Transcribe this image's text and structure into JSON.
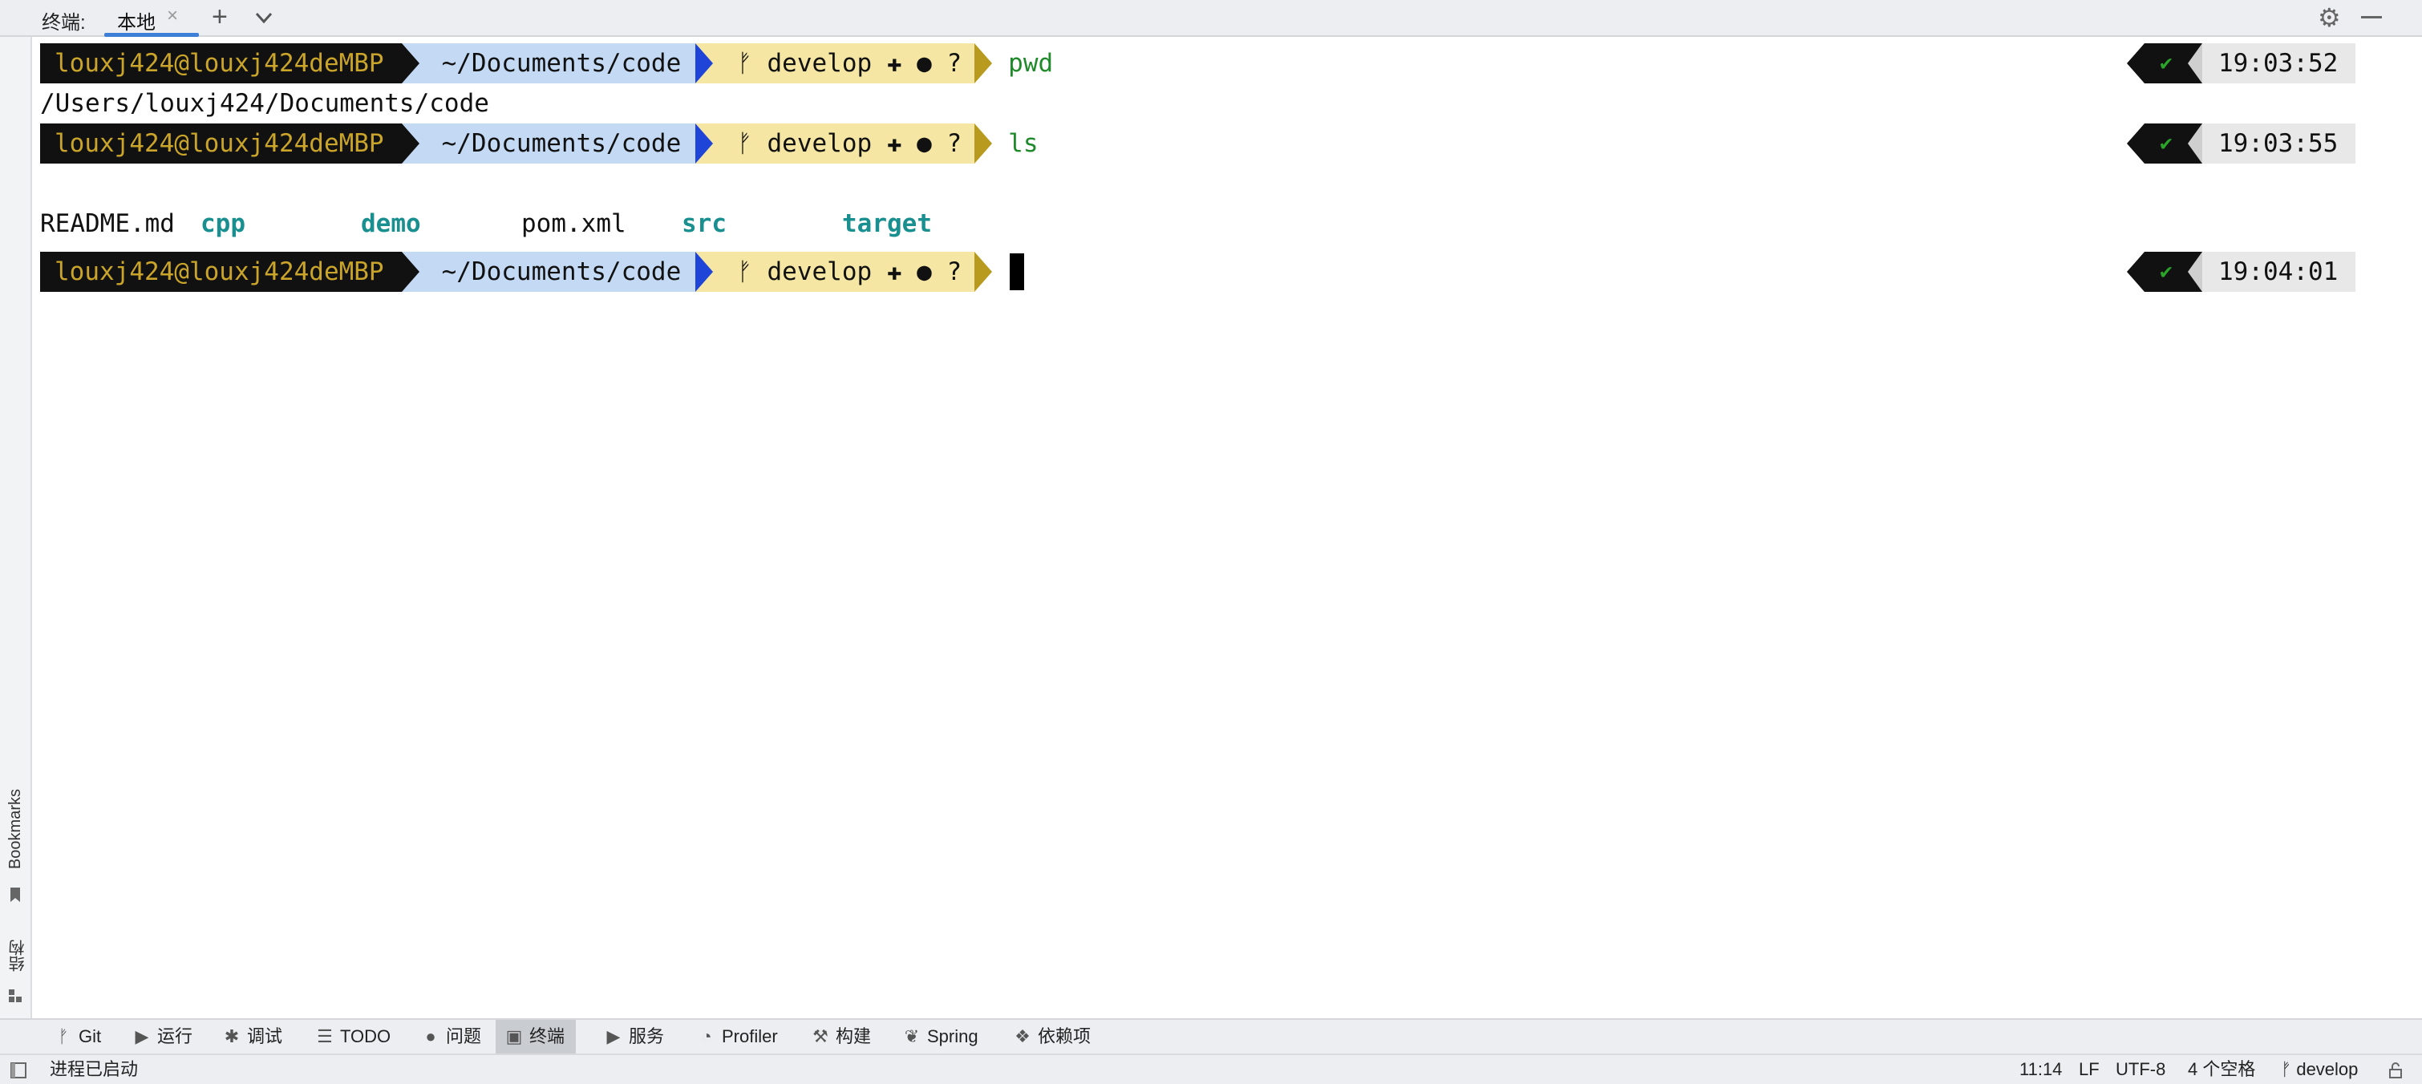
{
  "tabbar": {
    "title": "终端:",
    "active_tab": "本地",
    "close_glyph": "×",
    "plus_glyph": "+",
    "gear_glyph": "⚙"
  },
  "left_stripe": {
    "bookmarks_label": "Bookmarks",
    "structure_label": "结构"
  },
  "terminal": {
    "prompt": {
      "user": "louxj424@louxj424deMBP",
      "path": "~/Documents/code",
      "branch_icon": "ᚠ",
      "branch": "develop",
      "status": "✚ ● ?"
    },
    "lines": [
      {
        "command": "pwd",
        "time": "19:03:52"
      },
      {
        "command": "ls",
        "time": "19:03:55"
      },
      {
        "command": "",
        "time": "19:04:01"
      }
    ],
    "status_ok": "✔",
    "pwd_output": "/Users/louxj424/Documents/code",
    "ls_output": [
      {
        "name": "README.md",
        "kind": "file"
      },
      {
        "name": "cpp",
        "kind": "dir"
      },
      {
        "name": "demo",
        "kind": "dir"
      },
      {
        "name": "pom.xml",
        "kind": "file"
      },
      {
        "name": "src",
        "kind": "dir"
      },
      {
        "name": "target",
        "kind": "dir"
      }
    ]
  },
  "toolwindows": [
    {
      "label": "Git",
      "icon": "git-branch-icon",
      "glyph": "ᚠ"
    },
    {
      "label": "运行",
      "icon": "run-icon",
      "glyph": "▶"
    },
    {
      "label": "调试",
      "icon": "debug-icon",
      "glyph": "✱"
    },
    {
      "label": "TODO",
      "icon": "todo-list-icon",
      "glyph": "☰"
    },
    {
      "label": "问题",
      "icon": "problems-icon",
      "glyph": "●"
    },
    {
      "label": "终端",
      "icon": "terminal-icon",
      "glyph": "▣",
      "active": true
    },
    {
      "label": "服务",
      "icon": "services-icon",
      "glyph": "▶"
    },
    {
      "label": "Profiler",
      "icon": "profiler-icon",
      "glyph": "◔"
    },
    {
      "label": "构建",
      "icon": "build-hammer-icon",
      "glyph": "⚒"
    },
    {
      "label": "Spring",
      "icon": "spring-leaf-icon",
      "glyph": "❦"
    },
    {
      "label": "依赖项",
      "icon": "dependencies-icon",
      "glyph": "❖"
    }
  ],
  "statusbar": {
    "message": "进程已启动",
    "position": "11:14",
    "line_sep": "LF",
    "encoding": "UTF-8",
    "indent": "4 个空格",
    "branch": "develop"
  },
  "colors": {
    "user_bg": "#111111",
    "user_fg": "#caa52a",
    "path_bg": "#c4d9f3",
    "git_bg": "#f5e6a3",
    "command_fg": "#1f8a2a",
    "dir_fg": "#1a8f8f",
    "tab_underline": "#3d7fd6"
  }
}
